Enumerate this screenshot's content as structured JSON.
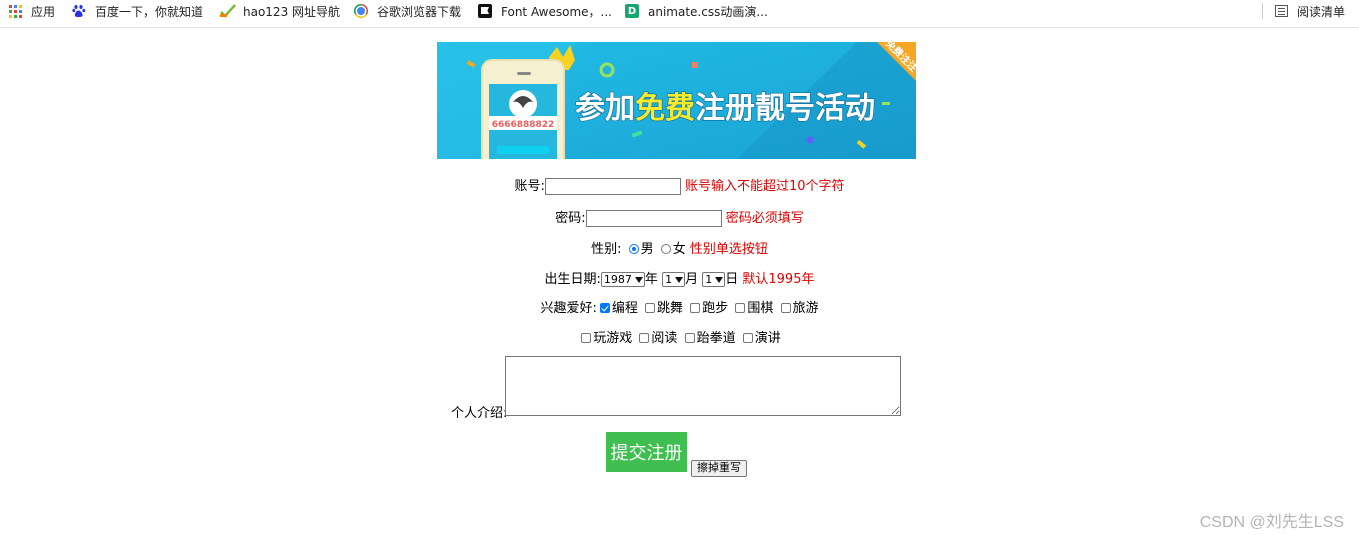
{
  "bookmarks": {
    "items": [
      {
        "label": "应用",
        "icon": "apps-grid-icon"
      },
      {
        "label": "百度一下，你就知道",
        "icon": "baidu-paw-icon"
      },
      {
        "label": "hao123 网址导航",
        "icon": "hao123-icon"
      },
      {
        "label": "谷歌浏览器下载",
        "icon": "chrome-icon"
      },
      {
        "label": "Font Awesome，...",
        "icon": "font-awesome-flag-icon"
      },
      {
        "label": "animate.css动画演...",
        "icon": "d-letter-icon"
      }
    ],
    "reading_list": "阅读清单"
  },
  "banner": {
    "text_1": "参加",
    "text_highlight": "免费",
    "text_2": "注册靓号活动",
    "phone_number": "6666888822",
    "corner_ribbon": "免费注注"
  },
  "form": {
    "account": {
      "label": "账号:",
      "value": "",
      "hint": "账号输入不能超过10个字符"
    },
    "password": {
      "label": "密码:",
      "value": "",
      "hint": "密码必须填写"
    },
    "gender": {
      "label": "性别:",
      "options": [
        "男",
        "女"
      ],
      "selected": "男",
      "hint": "性别单选按钮"
    },
    "birthday": {
      "label": "出生日期:",
      "year": "1987",
      "year_unit": "年",
      "month": "1",
      "month_unit": "月",
      "day": "1",
      "day_unit": "日",
      "hint": "默认1995年"
    },
    "hobbies": {
      "label": "兴趣爱好:",
      "row1": [
        {
          "label": "编程",
          "checked": true
        },
        {
          "label": "跳舞",
          "checked": false
        },
        {
          "label": "跑步",
          "checked": false
        },
        {
          "label": "围棋",
          "checked": false
        },
        {
          "label": "旅游",
          "checked": false
        }
      ],
      "row2": [
        {
          "label": "玩游戏",
          "checked": false
        },
        {
          "label": "阅读",
          "checked": false
        },
        {
          "label": "跆拳道",
          "checked": false
        },
        {
          "label": "演讲",
          "checked": false
        }
      ]
    },
    "intro": {
      "label": "个人介绍:",
      "value": ""
    },
    "submit_label": "提交注册",
    "reset_label": "擦掉重写"
  },
  "watermark": "CSDN @刘先生LSS",
  "colors": {
    "hint": "#e00000",
    "submit": "#3ebf4f",
    "banner_bg": "#1fb3dd",
    "accent": "#0075ff"
  }
}
